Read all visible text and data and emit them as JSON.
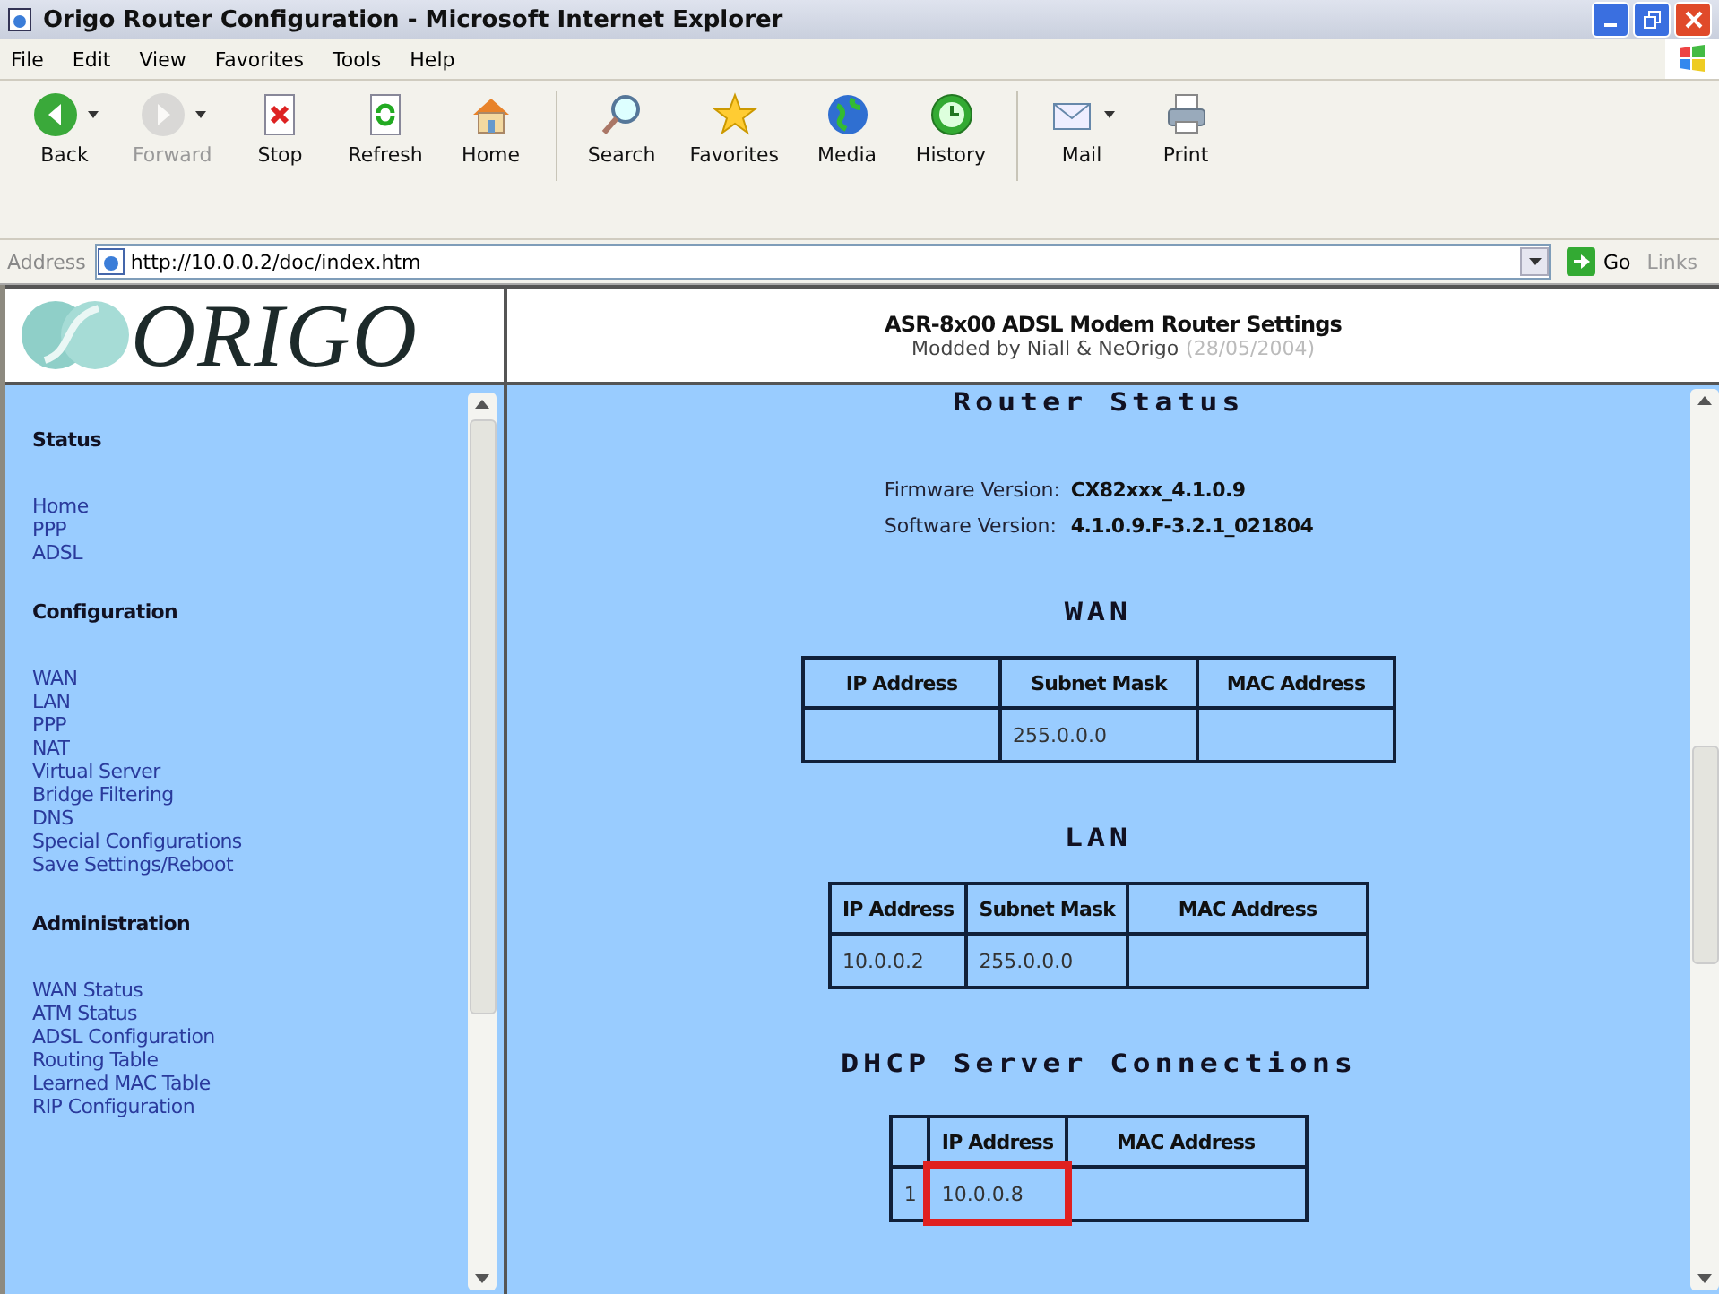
{
  "window": {
    "title": "Origo Router Configuration - Microsoft Internet Explorer"
  },
  "menu": [
    "File",
    "Edit",
    "View",
    "Favorites",
    "Tools",
    "Help"
  ],
  "toolbar": [
    {
      "label": "Back",
      "disabled": false,
      "dropdown": true
    },
    {
      "label": "Forward",
      "disabled": true,
      "dropdown": true
    },
    {
      "label": "Stop",
      "disabled": false,
      "dropdown": false
    },
    {
      "label": "Refresh",
      "disabled": false,
      "dropdown": false
    },
    {
      "label": "Home",
      "disabled": false,
      "dropdown": false
    },
    {
      "label": "Search",
      "disabled": false,
      "dropdown": false
    },
    {
      "label": "Favorites",
      "disabled": false,
      "dropdown": false
    },
    {
      "label": "Media",
      "disabled": false,
      "dropdown": false
    },
    {
      "label": "History",
      "disabled": false,
      "dropdown": false
    },
    {
      "label": "Mail",
      "disabled": false,
      "dropdown": true
    },
    {
      "label": "Print",
      "disabled": false,
      "dropdown": false
    }
  ],
  "address_bar": {
    "label": "Address",
    "value": "http://10.0.0.2/doc/index.htm",
    "go": "Go",
    "links": "Links"
  },
  "logo": {
    "text": "ORIGO"
  },
  "header": {
    "title": "ASR-8x00 ADSL Modem Router Settings",
    "subtitle": "Modded by Niall & NeOrigo",
    "date": "(28/05/2004)"
  },
  "sidebar": {
    "sections": [
      {
        "title": "Status",
        "items": [
          "Home",
          "PPP",
          "ADSL"
        ]
      },
      {
        "title": "Configuration",
        "items": [
          "WAN",
          "LAN",
          "PPP",
          "NAT",
          "Virtual Server",
          "Bridge Filtering",
          "DNS",
          "Special Configurations",
          "Save Settings/Reboot"
        ]
      },
      {
        "title": "Administration",
        "items": [
          "WAN Status",
          "ATM Status",
          "ADSL Configuration",
          "Routing Table",
          "Learned MAC Table",
          "RIP Configuration"
        ]
      }
    ]
  },
  "content": {
    "title": "Router Status",
    "versions": [
      {
        "label": "Firmware Version:",
        "value": "CX82xxx_4.1.0.9"
      },
      {
        "label": "Software Version:",
        "value": "4.1.0.9.F-3.2.1_021804"
      }
    ],
    "tables": [
      {
        "title": "WAN",
        "columns": [
          "IP Address",
          "Subnet Mask",
          "MAC Address"
        ],
        "rows": [
          [
            {
              "text": ""
            },
            {
              "text": "255.0.0.0"
            },
            {
              "text": ""
            }
          ]
        ]
      },
      {
        "title": "LAN",
        "columns": [
          "IP Address",
          "Subnet Mask",
          "MAC Address"
        ],
        "rows": [
          [
            {
              "text": "10.0.0.2"
            },
            {
              "text": "255.0.0.0"
            },
            {
              "text": ""
            }
          ]
        ]
      },
      {
        "title": "DHCP Server Connections",
        "columns": [
          "",
          "IP Address",
          "MAC Address"
        ],
        "rows": [
          [
            {
              "text": "1",
              "highlighted": false
            },
            {
              "text": "10.0.0.8",
              "highlighted": true
            },
            {
              "text": "",
              "highlighted": false
            }
          ]
        ]
      }
    ]
  }
}
